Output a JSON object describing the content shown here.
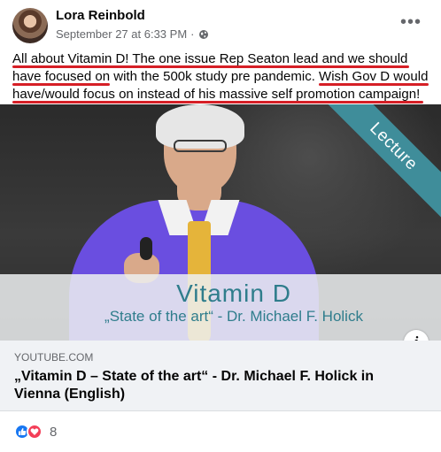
{
  "post": {
    "author": "Lora Reinbold",
    "timestamp": "September 27 at 6:33 PM",
    "separator": "·",
    "privacy_icon": "globe-icon",
    "more_label": "•••",
    "text_line1": "All about Vitamin D! The one issue Rep Seaton lead and we should",
    "text_line2": "have focused on with the 500k study pre pandemic. Wish Gov D would",
    "text_line3": "have/would  focus on instead of his massive self promotion campaign!"
  },
  "media": {
    "corner_ribbon": "Lecture",
    "title": "Vitamin D",
    "subtitle": "„State of the art“ - Dr. Michael F. Holick",
    "info_label": "i"
  },
  "link": {
    "domain": "YOUTUBE.COM",
    "title": "„Vitamin D – State of the art“ - Dr. Michael F. Holick in Vienna (English)"
  },
  "reactions": {
    "icons": [
      "like-icon",
      "love-icon"
    ],
    "count": "8"
  },
  "colors": {
    "underline": "#d61f26",
    "like": "#1877f2",
    "love": "#f33e58",
    "teal": "#2f7d8c"
  }
}
